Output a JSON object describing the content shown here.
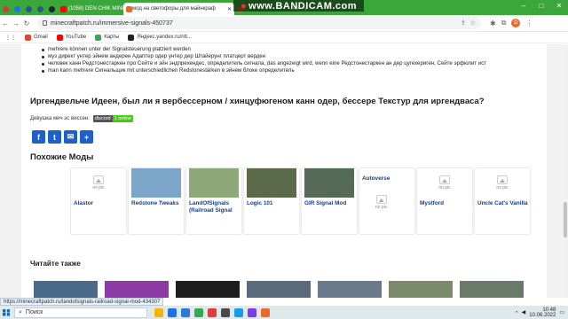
{
  "browser": {
    "tabs": [
      {
        "type": "mini",
        "color": "#d23c3c"
      },
      {
        "type": "mini",
        "color": "#1a73e8"
      },
      {
        "type": "mini",
        "color": "#2a5885"
      },
      {
        "type": "mini",
        "color": "#2a5885"
      },
      {
        "type": "mini",
        "color": "#1b2838"
      },
      {
        "type": "wide",
        "label": "(1058) DEN CHIK MINECRAFT - ",
        "color": "#ff0000"
      },
      {
        "type": "active",
        "label": "мод на светофоры для майнкраф",
        "color": "#e9682a"
      },
      {
        "type": "wide",
        "label": "",
        "color": "#e9682a"
      }
    ],
    "partial_tab_text": "nals мод",
    "recorder_watermark": "www.BANDICAM.com",
    "url": "minecraftpatch.ru/immersive-signals-450737",
    "bookmarks": [
      {
        "label": "Gmail",
        "color": "#ea4335"
      },
      {
        "label": "YouTube",
        "color": "#ff0000"
      },
      {
        "label": "Карты",
        "color": "#34a853"
      },
      {
        "label": "Яндекс.yandex.ru/ntt...",
        "color": "#222222"
      }
    ],
    "profile_initial": "D"
  },
  "article": {
    "bullets": [
      "mehrere können unter der Signalsteuerung platziert werden",
      "муз директ унтер эйнем андерен Адаптер одер унтер дер Штайерунг платцерт верден",
      "человек канн Редстонестаркен про Сейте и эйн эндпрехендес, определитель сигнала, das angezeigt wird, wenn eine Редстонестаркен ан дер цугехериген, Сейте эрфюлит ист",
      "man kann mehrere Сигнальщик mit unterschiedlichen Redstonestärken в эйнем блоке определитель"
    ],
    "question": "Иргендвельче Идеен, был ли я вербессерном / хинцуфюгеном канн одер, бессере Текстур для иргендваса?",
    "players_text": "Девушка мич эс виссен:",
    "discord_label": "discord",
    "discord_count": "1 online",
    "share_icons": [
      "facebook-icon",
      "twitter-icon",
      "email-icon",
      "share-plus-icon"
    ],
    "similar_title": "Похожие Моды",
    "no_pic_label": "no pic",
    "similar_mods": [
      {
        "name": "Alastor",
        "has_image": false,
        "thumb": ""
      },
      {
        "name": "Redstone Tweaks",
        "has_image": true,
        "thumb": "#7ca6c9"
      },
      {
        "name": "LandOfSignals (Railroad Signal",
        "has_image": true,
        "thumb": "#8da879"
      },
      {
        "name": "Logic 101",
        "has_image": true,
        "thumb": "#5b6b4a"
      },
      {
        "name": "GIR Signal Mod",
        "has_image": true,
        "thumb": "#566b57"
      },
      {
        "name": "Autoverse",
        "has_image": false,
        "thumb": "",
        "title_top": true
      },
      {
        "name": "Mystford",
        "has_image": false,
        "thumb": ""
      },
      {
        "name": "Uncle Cat's Vanilla",
        "has_image": false,
        "thumb": ""
      }
    ],
    "read_also_title": "Читайте также",
    "read_also_thumbs": [
      "#4a6a8a",
      "#8b3aa6",
      "#1e1e1e",
      "#5a6a7a",
      "#6a7a8a",
      "#7a8a6a",
      "#6a7a6a"
    ]
  },
  "status_url": "https://minecraftpatch.ru/landofsignals-railroad-signal-mod-434307",
  "taskbar": {
    "search_placeholder": "Поиск",
    "app_icon_colors": [
      "#f5b400",
      "#1a73e8",
      "#2c7ad6",
      "#34a853",
      "#e33b3b",
      "#4a4a4a",
      "#1c9be8",
      "#7b3fe4",
      "#e9682a"
    ],
    "time": "10:48",
    "date": "10.06.2022"
  }
}
